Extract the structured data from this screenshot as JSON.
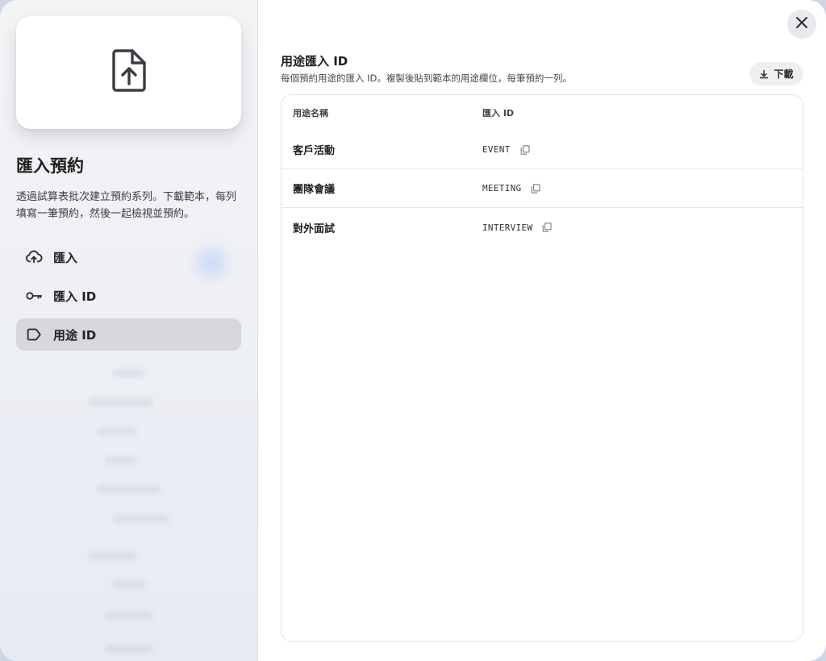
{
  "sidebar": {
    "title": "匯入預約",
    "description": "透過試算表批次建立預約系列。下載範本，每列填寫一筆預約，然後一起檢視並預約。",
    "nav": [
      {
        "label": "匯入",
        "icon": "cloud-upload-icon"
      },
      {
        "label": "匯入 ID",
        "icon": "key-icon"
      },
      {
        "label": "用途 ID",
        "icon": "label-icon",
        "active": true
      }
    ]
  },
  "main": {
    "title": "用途匯入 ID",
    "description": "每個預約用途的匯入 ID。複製後貼到範本的用途欄位，每筆預約一列。",
    "download_label": "下載",
    "table": {
      "headers": [
        "用途名稱",
        "匯入 ID"
      ],
      "rows": [
        {
          "name": "客戶活動",
          "id": "EVENT"
        },
        {
          "name": "團隊會議",
          "id": "MEETING"
        },
        {
          "name": "對外面試",
          "id": "INTERVIEW"
        }
      ]
    }
  },
  "colors": {
    "accent": "#1f1f1f",
    "active_nav_bg": "#d7d8db"
  }
}
